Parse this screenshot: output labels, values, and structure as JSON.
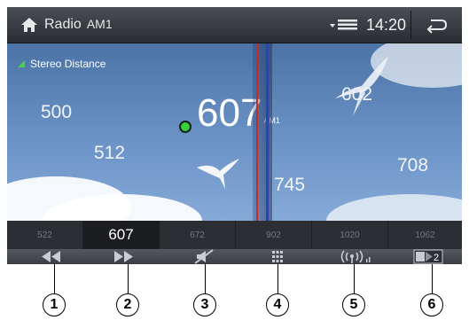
{
  "header": {
    "title": "Radio",
    "band": "AM1",
    "time": "14:20",
    "icons": [
      "home-icon",
      "signal-strength-icon",
      "back-icon"
    ]
  },
  "tuner": {
    "status": "Stereo  Distance",
    "current_frequency": "607",
    "current_band": "AM1",
    "frequencies": [
      "500",
      "512",
      "602",
      "708",
      "745"
    ]
  },
  "presets": [
    "522",
    "607",
    "672",
    "902",
    "1020",
    "1062"
  ],
  "controls": {
    "icons": [
      "seek-back-icon",
      "seek-forward-icon",
      "mute-icon",
      "preset-grid-icon",
      "antenna-icon",
      "band-switch-icon"
    ],
    "band_switch_label": "2"
  },
  "callouts": [
    "1",
    "2",
    "3",
    "4",
    "5",
    "6"
  ],
  "colors": {
    "accent_green": "#35d13a",
    "needle_red": "#c9292e",
    "needle_blue": "#2a47a3"
  }
}
